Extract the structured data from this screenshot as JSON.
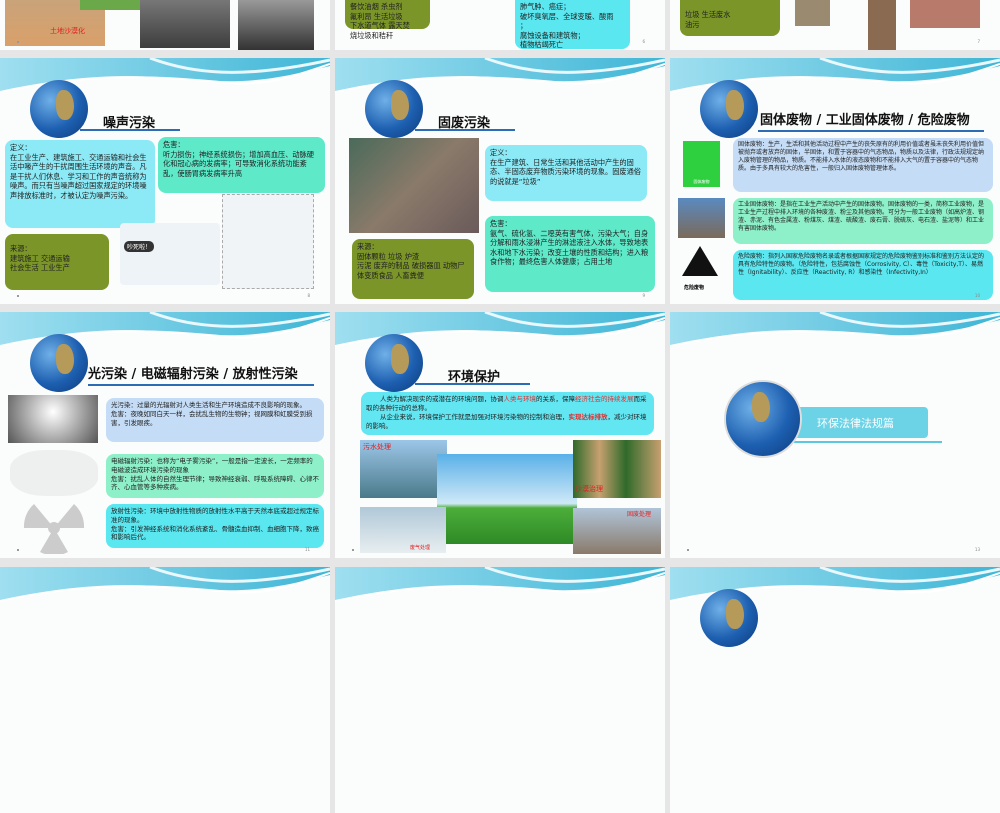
{
  "slides": [
    {
      "number": "5",
      "labels": [
        "土地沙漠化"
      ]
    },
    {
      "number": "6",
      "source_lines": "餐饮油烟 杀虫剂\n氟利昂 生活垃圾\n下水道气体 露天焚\n烧垃圾和秸秆",
      "harm_lines": "肺气肿、癌症；\n破坏臭氧层、全球变暖、酸雨\n；\n腐蚀设备和建筑物；\n植物枯竭死亡"
    },
    {
      "number": "7",
      "source_lines": "垃圾 生活废水\n油污"
    },
    {
      "number": "8",
      "title": "噪声污染",
      "definition": "定义：\n在工业生产、建筑施工、交通运输和社会生活中喙产生的干扰周围生活环境的声音。凡是干扰人们休息、学习和工作的声音统称为噪声。而只有当噪声超过国家规定的环境噪声排放标准时，才被认定为噪声污染。",
      "harm": "危害：\n听力损伤；神经系统损伤；增加高血压、动脉硬化和冠心病的发病率；可导致消化系统功能紊乱，使肠胃病发病率升高",
      "source": "来源：\n建筑施工 交通运输\n社会生活 工业生产",
      "cartoon_text": "吵死啦！"
    },
    {
      "number": "9",
      "title": "固废污染",
      "definition": "定义：\n在生产建筑、日常生活和其他活动中产生的固态、半固态废弃物质污染环境的现象。固废通俗的说就是“垃圾”",
      "harm": "危害：\n氨气、硫化氢、二噁英有害气体，污染大气；自身分解和雨水浸淋产生的淋滤液注入水体，导致地表水和地下水污染；改变土壤的性质和结构；进入粮食作物；最终危害人体健康；占用土地",
      "source": "来源：\n固体颗粒 垃圾 炉渣\n污泥 废弃的制品 破损器皿 动物尸体变质食品 人畜粪便"
    },
    {
      "number": "10",
      "title": "固体废物 / 工业固体废物 / 危险废物",
      "sign1": "固体废物",
      "sign2": "危险废物",
      "solid": "固体废物：生产，生活和其他活动过程中产生的丧失原有的利用价值或者虽未丧失利用价值但被抛弃或者放弃的固体，半固体，和置于容器中的气态物品，物质以及法律，行政法规规定纳入废物管理的物品，物质。不能排入水体的液态废物和不能排入大气的置于容器中的气态物质。由于多具有较大的危害性，一般归入固体废物管理体系。",
      "industrial": "工业固体废物：是指在工业生产活动中产生的固体废物。固体废物的一类，简称工业废物，是工业生产过程中排入环境的各种废渣、粉尘及其他废物。可分为一般工业废物（如高炉渣、钢渣、赤泥、有色金属渣、粉煤灰、煤渣、硫酸渣、废石膏、脱硫灰、电石渣、盐泥等）和工业有害固体废物。",
      "hazardous": "危险废物：指列入国家危险废物名录或者根据国家规定的危险废物鉴别标准和鉴别方法认定的具有危险特性的废物。（危险特性，包括腐蚀性（Corrosivity, C）、毒性（Toxicity,T）、易燃性（Ignitability）、反应性（Reactivity, R）和感染性（Infectivity,In）"
    },
    {
      "number": "11",
      "title": "光污染 / 电磁辐射污染 / 放射性污染",
      "light": "光污染：过量的光辐射对人类生活和生产环境造成不良影响的现象。\n危害：夜晚如同白天一样，会扰乱生物的生物钟；视网膜和虹膜受到损害，引发眼疾。",
      "em": "电磁辐射污染：也称为“电子雾污染”，一般是指一定波长，一定频率的电磁波造成环境污染的现象\n危害：扰乱人体的自然生理节律；导致神经衰弱、呼吸系统障碍、心律不齐、心血管等多种疾病。",
      "radio": "放射性污染：环境中放射性物质的放射性水平高于天然本底或超过规定标准的现象。\n危害：引发神经系统和消化系统紊乱、骨髓造血抑制、血细胞下降，致癌和影响后代。"
    },
    {
      "number": "12",
      "title": "环境保护",
      "p1a": "人类为解决现实的或潜在的环境问题，协调",
      "p1b": "人类与环境",
      "p1c": "的关系，保障",
      "p1d": "经济社会的持续发展",
      "p1e": "而采取的各种行动的总称。",
      "p2a": "从企业来说，环境保护工作就是加强对环境污染物的控制和治理，",
      "p2b": "实现达标排放",
      "p2c": "，减少对环境的影响。",
      "labels": [
        "污水处理",
        "沙漠治理",
        "固废处理",
        "废气处理"
      ]
    },
    {
      "number": "13",
      "section_title": "环保法律法规篇"
    }
  ],
  "colors": {
    "accent": "#2b6cb5",
    "olive": "#7b9529",
    "cyan": "#8ce9f6",
    "mint": "#5ee9c9"
  }
}
